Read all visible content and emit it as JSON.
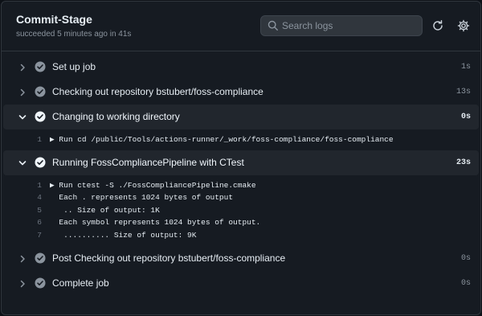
{
  "header": {
    "title": "Commit-Stage",
    "subtitle": "succeeded 5 minutes ago in 41s",
    "search_placeholder": "Search logs",
    "refresh_icon": "refresh-icon",
    "settings_icon": "gear-icon"
  },
  "colors": {
    "background": "#161b22",
    "border": "#30363d",
    "check": "#8b949e",
    "expanded_bg": "#21262d"
  },
  "steps": [
    {
      "label": "Set up job",
      "duration": "1s",
      "expanded": false
    },
    {
      "label": "Checking out repository bstubert/foss-compliance",
      "duration": "13s",
      "expanded": false
    },
    {
      "label": "Changing to working directory",
      "duration": "0s",
      "expanded": true,
      "log": [
        {
          "num": "1",
          "text": "▶ Run cd /public/Tools/actions-runner/_work/foss-compliance/foss-compliance"
        }
      ]
    },
    {
      "label": "Running FossCompliancePipeline with CTest",
      "duration": "23s",
      "expanded": true,
      "log": [
        {
          "num": "1",
          "text": "▶ Run ctest -S ./FossCompliancePipeline.cmake"
        },
        {
          "num": "4",
          "text": "  Each . represents 1024 bytes of output"
        },
        {
          "num": "5",
          "text": "   .. Size of output: 1K"
        },
        {
          "num": "6",
          "text": "  Each symbol represents 1024 bytes of output."
        },
        {
          "num": "7",
          "text": "   .......... Size of output: 9K"
        }
      ]
    },
    {
      "label": "Post Checking out repository bstubert/foss-compliance",
      "duration": "0s",
      "expanded": false
    },
    {
      "label": "Complete job",
      "duration": "0s",
      "expanded": false
    }
  ]
}
